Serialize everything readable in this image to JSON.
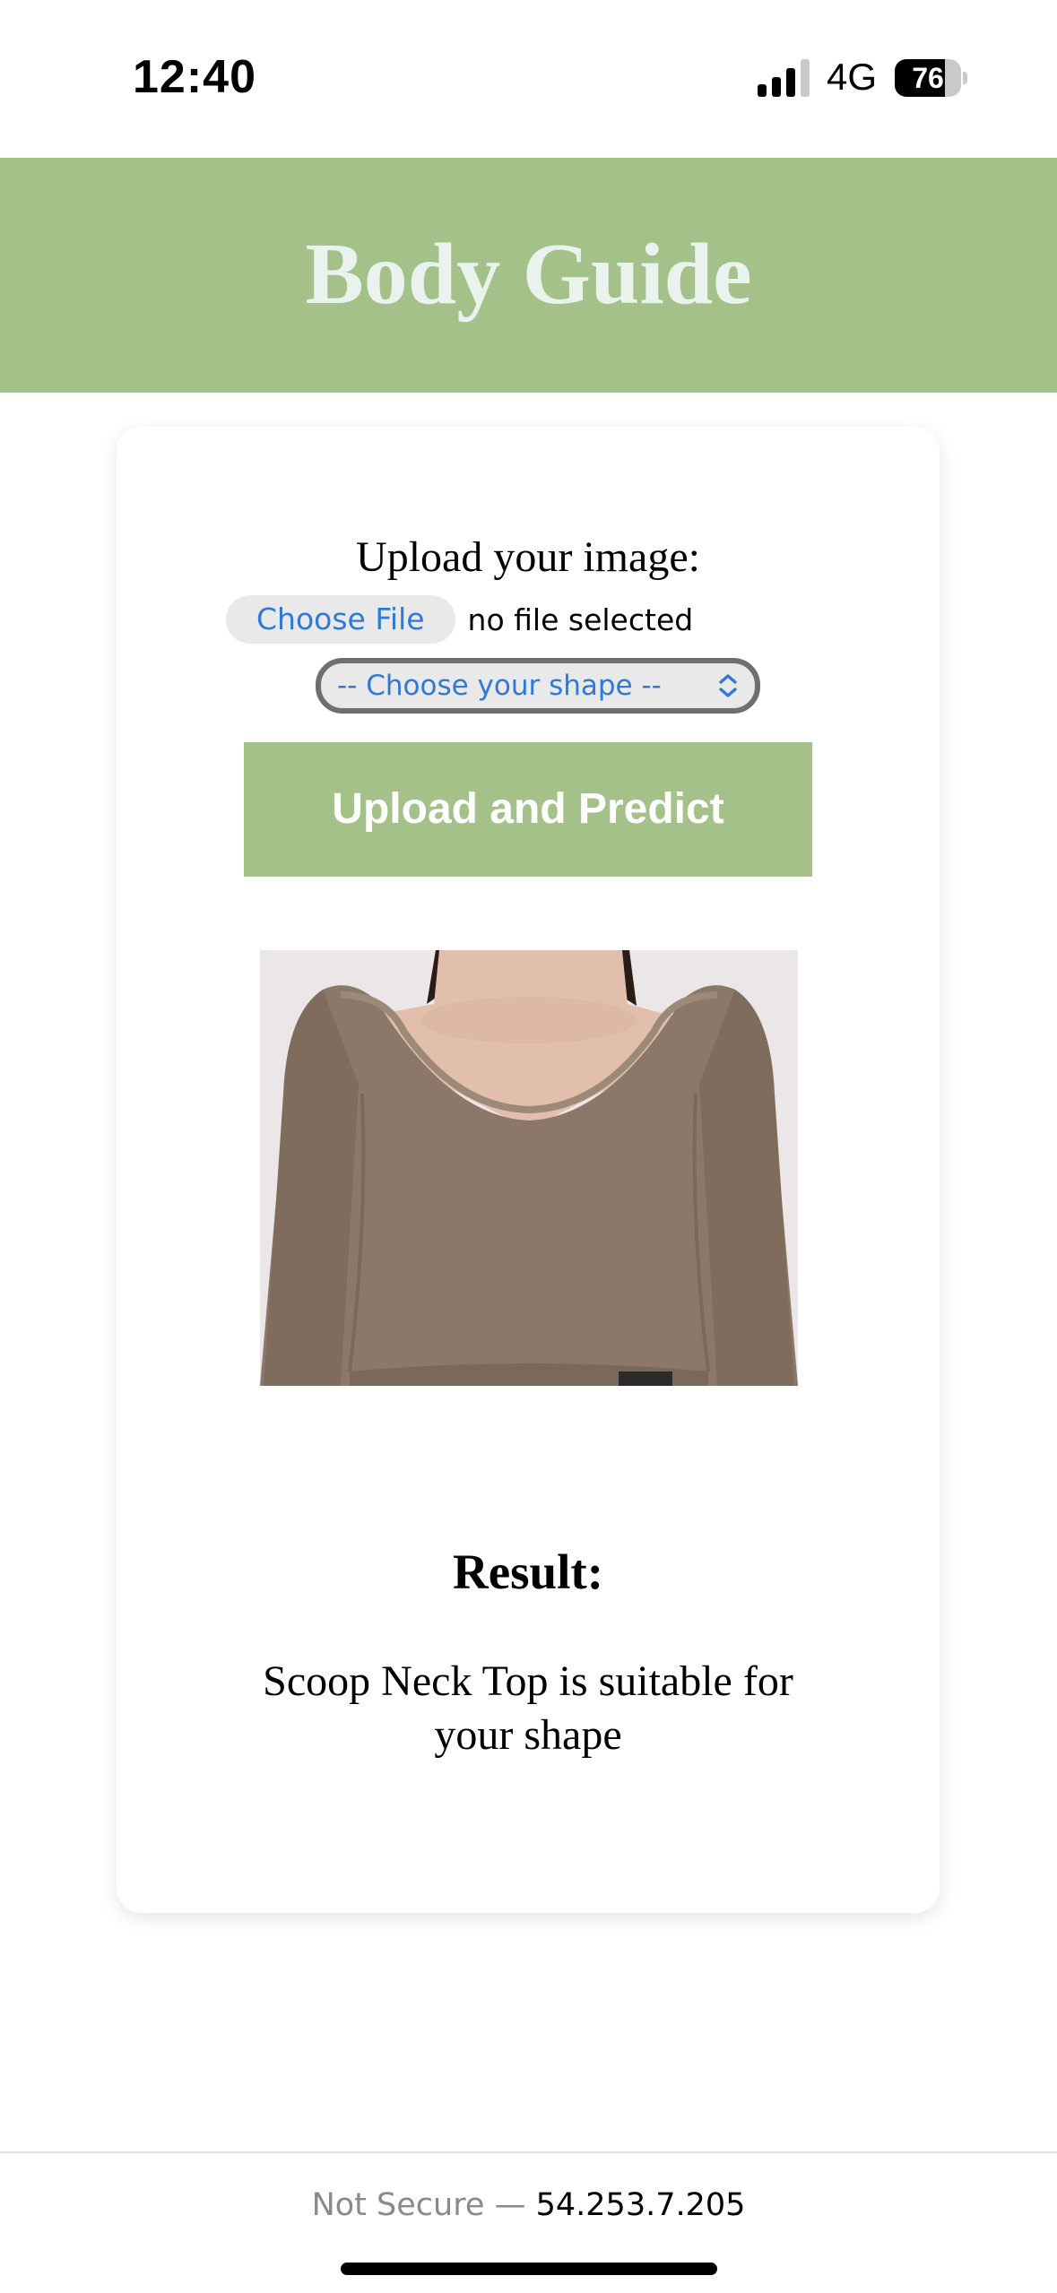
{
  "status_bar": {
    "time": "12:40",
    "network": "4G",
    "battery_level": "76",
    "battery_fraction": 0.76,
    "signal_bars_active": 3,
    "signal_bars_total": 4
  },
  "header": {
    "title": "Body Guide"
  },
  "upload_form": {
    "label": "Upload your image:",
    "choose_file_label": "Choose File",
    "file_status": "no file selected",
    "shape_select_value": "-- Choose your shape --",
    "submit_label": "Upload and Predict"
  },
  "preview": {
    "icon": "photo-scoop-neck-top"
  },
  "result": {
    "heading": "Result:",
    "text": "Scoop Neck Top is suitable for your shape"
  },
  "browser": {
    "security_label": "Not Secure",
    "separator": " — ",
    "host": "54.253.7.205"
  },
  "colors": {
    "accent_green": "#a3c189",
    "title_text": "#e9f2ec",
    "link_blue": "#2f7ad9",
    "top_color": "#8b7868"
  }
}
